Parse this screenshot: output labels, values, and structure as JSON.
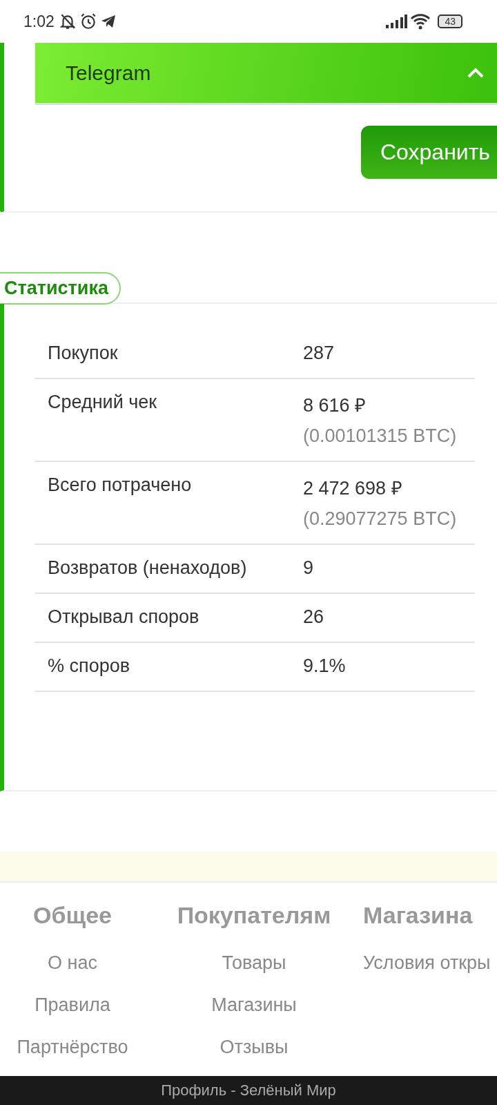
{
  "status_bar": {
    "time": "1:02",
    "battery": "43"
  },
  "telegram_section": {
    "title": "Telegram",
    "expanded": true
  },
  "save_button": "Сохранить",
  "stats": {
    "title": "Статистика",
    "rows": [
      {
        "label": "Покупок",
        "value": "287"
      },
      {
        "label": "Средний чек",
        "value": "8 616 ₽",
        "secondary": "(0.00101315 BTC)"
      },
      {
        "label": "Всего потрачено",
        "value": "2 472 698 ₽",
        "secondary": "(0.29077275 BTC)"
      },
      {
        "label": "Возвратов (ненаходов)",
        "value": "9"
      },
      {
        "label": "Открывал споров",
        "value": "26"
      },
      {
        "label": "% споров",
        "value": "9.1%"
      }
    ]
  },
  "footer": {
    "columns": [
      {
        "title": "Общее",
        "links": [
          "О нас",
          "Правила",
          "Партнёрство"
        ]
      },
      {
        "title": "Покупателям",
        "links": [
          "Товары",
          "Магазины",
          "Отзывы"
        ]
      },
      {
        "title": "Магазина",
        "links": [
          "Условия откры"
        ]
      }
    ],
    "page_title": "Профиль - Зелёный Мир"
  }
}
